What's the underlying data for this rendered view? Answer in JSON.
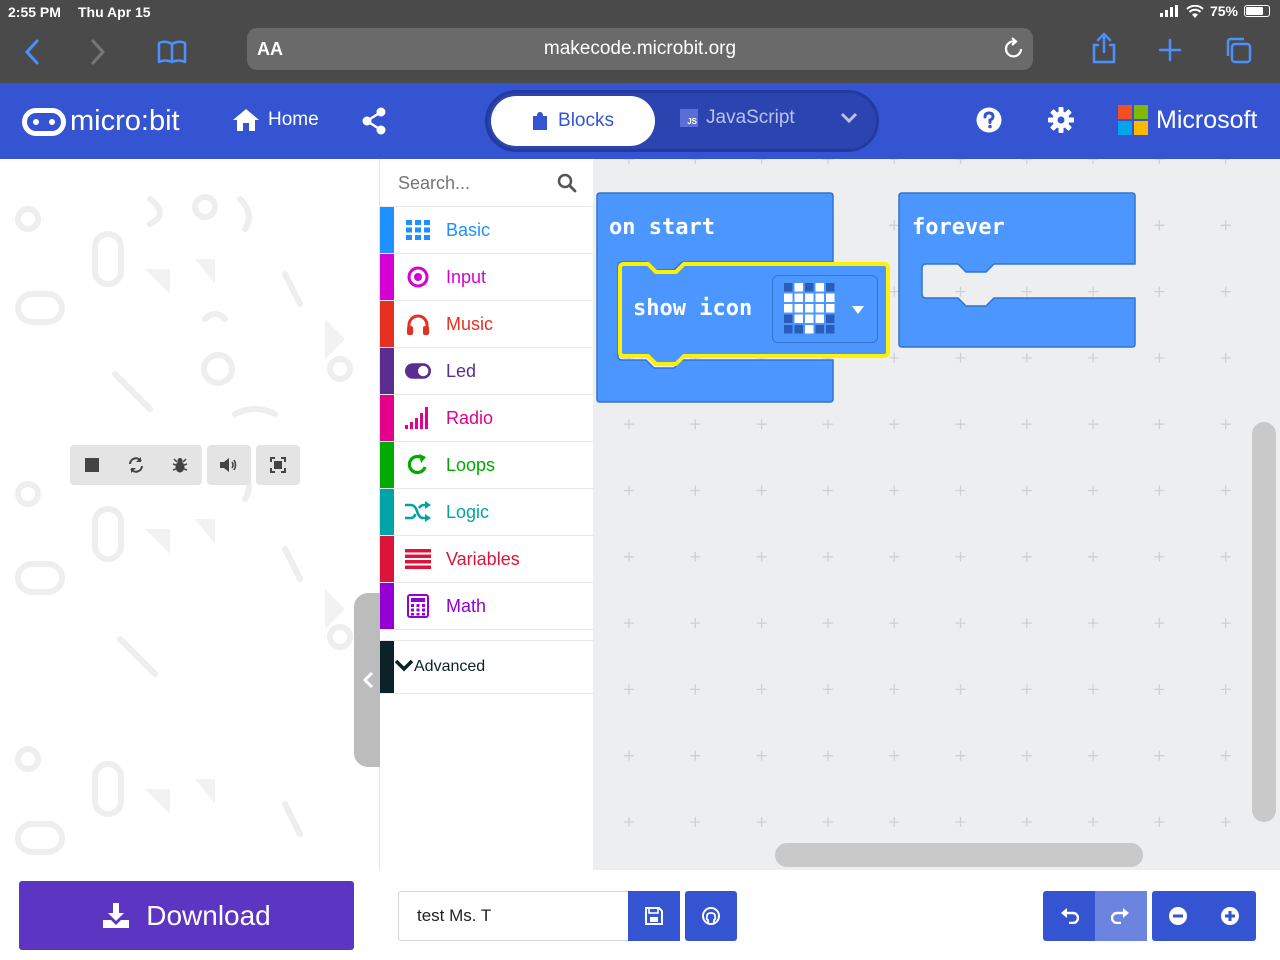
{
  "statusbar": {
    "time": "2:55 PM",
    "date": "Thu Apr 15",
    "battery": "75%"
  },
  "browser": {
    "text_size_label": "AA",
    "url": "makecode.microbit.org"
  },
  "header": {
    "logo": "micro:bit",
    "home_label": "Home",
    "tabs": {
      "blocks": "Blocks",
      "javascript": "JavaScript",
      "js_badge": "JS"
    },
    "brand": "Microsoft",
    "brand_colors": [
      "#f25022",
      "#7fba00",
      "#00a4ef",
      "#ffb900"
    ],
    "accent": "#3454d1"
  },
  "toolbox": {
    "search_placeholder": "Search...",
    "categories": [
      {
        "label": "Basic",
        "color": "#1e90ff",
        "icon": "grid-icon"
      },
      {
        "label": "Input",
        "color": "#d400d4",
        "icon": "target-icon"
      },
      {
        "label": "Music",
        "color": "#e63022",
        "icon": "headphones-icon"
      },
      {
        "label": "Led",
        "color": "#5c2d91",
        "icon": "toggle-icon"
      },
      {
        "label": "Radio",
        "color": "#e3008c",
        "icon": "signal-icon"
      },
      {
        "label": "Loops",
        "color": "#00aa00",
        "icon": "loop-icon"
      },
      {
        "label": "Logic",
        "color": "#00a4a6",
        "icon": "shuffle-icon"
      },
      {
        "label": "Variables",
        "color": "#dc143c",
        "icon": "lines-icon"
      },
      {
        "label": "Math",
        "color": "#9400d3",
        "icon": "calculator-icon"
      }
    ],
    "advanced_label": "Advanced"
  },
  "workspace": {
    "on_start_label": "on start",
    "show_icon_label": "show icon",
    "forever_label": "forever",
    "icon_pattern": [
      [
        0,
        1,
        0,
        1,
        0
      ],
      [
        1,
        1,
        1,
        1,
        1
      ],
      [
        1,
        1,
        1,
        1,
        1
      ],
      [
        0,
        1,
        1,
        1,
        0
      ],
      [
        0,
        0,
        1,
        0,
        0
      ]
    ]
  },
  "bottom": {
    "download_label": "Download",
    "project_name": "test Ms. T"
  }
}
